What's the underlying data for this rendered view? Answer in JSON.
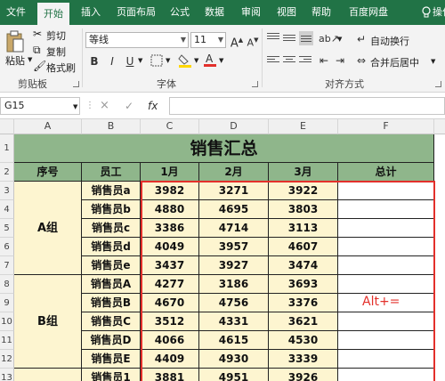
{
  "tabs": [
    "文件",
    "开始",
    "插入",
    "页面布局",
    "公式",
    "数据",
    "审阅",
    "视图",
    "帮助",
    "百度网盘",
    "操作说明"
  ],
  "ribbon": {
    "paste": "粘贴",
    "cut": "剪切",
    "copy": "复制",
    "format_painter": "格式刷",
    "clipboard_label": "剪贴板",
    "font_name": "等线",
    "font_size": "11",
    "bold": "B",
    "italic": "I",
    "underline": "U",
    "font_label": "字体",
    "wrap_text": "自动换行",
    "merge_center": "合并后居中",
    "align_label": "对齐方式"
  },
  "formula_bar": {
    "name_box": "G15",
    "cancel": "×",
    "confirm": "✓",
    "fx": "fx",
    "value": ""
  },
  "columns": [
    "A",
    "B",
    "C",
    "D",
    "E",
    "F"
  ],
  "rows": [
    "1",
    "2",
    "3",
    "4",
    "5",
    "6",
    "7",
    "8",
    "9",
    "10",
    "11",
    "12",
    "13"
  ],
  "sheet": {
    "title": "销售汇总",
    "headers": [
      "序号",
      "员工",
      "1月",
      "2月",
      "3月",
      "总计"
    ],
    "groups": [
      "A组",
      "B组"
    ],
    "names": [
      "销售员a",
      "销售员b",
      "销售员c",
      "销售员d",
      "销售员e",
      "销售员A",
      "销售员B",
      "销售员C",
      "销售员D",
      "销售员E",
      "销售员1"
    ],
    "data": [
      [
        "3982",
        "3271",
        "3922"
      ],
      [
        "4880",
        "4695",
        "3803"
      ],
      [
        "3386",
        "4714",
        "3113"
      ],
      [
        "4049",
        "3957",
        "4607"
      ],
      [
        "3437",
        "3927",
        "3474"
      ],
      [
        "4277",
        "3186",
        "3693"
      ],
      [
        "4670",
        "4756",
        "3376"
      ],
      [
        "3512",
        "4331",
        "3621"
      ],
      [
        "4066",
        "4615",
        "4530"
      ],
      [
        "4409",
        "4930",
        "3339"
      ],
      [
        "3881",
        "4951",
        "3926"
      ]
    ],
    "annotation": "Alt+="
  }
}
